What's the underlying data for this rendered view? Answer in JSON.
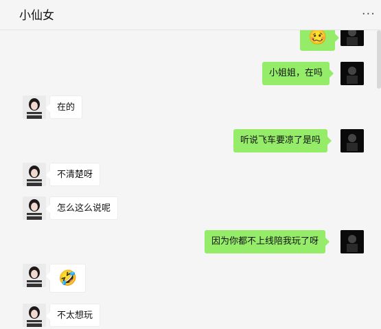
{
  "header": {
    "title": "小仙女",
    "more_icon": "···"
  },
  "messages": [
    {
      "from": "me",
      "text": "🥴"
    },
    {
      "from": "me",
      "text": "小姐姐，在吗"
    },
    {
      "from": "her",
      "text": "在的"
    },
    {
      "from": "me",
      "text": "听说飞车要凉了是吗"
    },
    {
      "from": "her",
      "text": "不清楚呀"
    },
    {
      "from": "her",
      "text": "怎么这么说呢"
    },
    {
      "from": "me",
      "text": "因为你都不上线陪我玩了呀"
    },
    {
      "from": "her",
      "text": "🤣"
    },
    {
      "from": "her",
      "text": "不太想玩"
    }
  ],
  "colors": {
    "my_bubble": "#95ec69",
    "her_bubble": "#ffffff",
    "background": "#f5f5f5"
  }
}
